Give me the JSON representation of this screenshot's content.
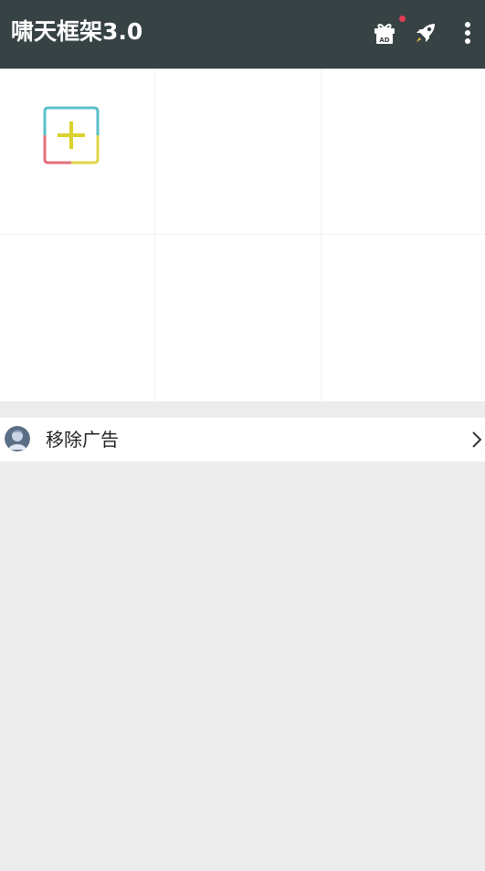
{
  "appbar": {
    "title": "啸天框架3.0",
    "background": "#374244",
    "actions": [
      {
        "icon": "gift-ad-icon",
        "badge": true
      },
      {
        "icon": "rocket-icon"
      },
      {
        "icon": "overflow-menu-icon"
      }
    ],
    "gift_badge_text": "AD",
    "badge_color": "#e23c55"
  },
  "grid": {
    "columns": 3,
    "rows": 2,
    "first_tile_icon": "add-icon"
  },
  "list": {
    "remove_ads_label": "移除广告",
    "remove_ads_icon": "avatar-icon",
    "chevron_icon": "chevron-right-icon"
  }
}
